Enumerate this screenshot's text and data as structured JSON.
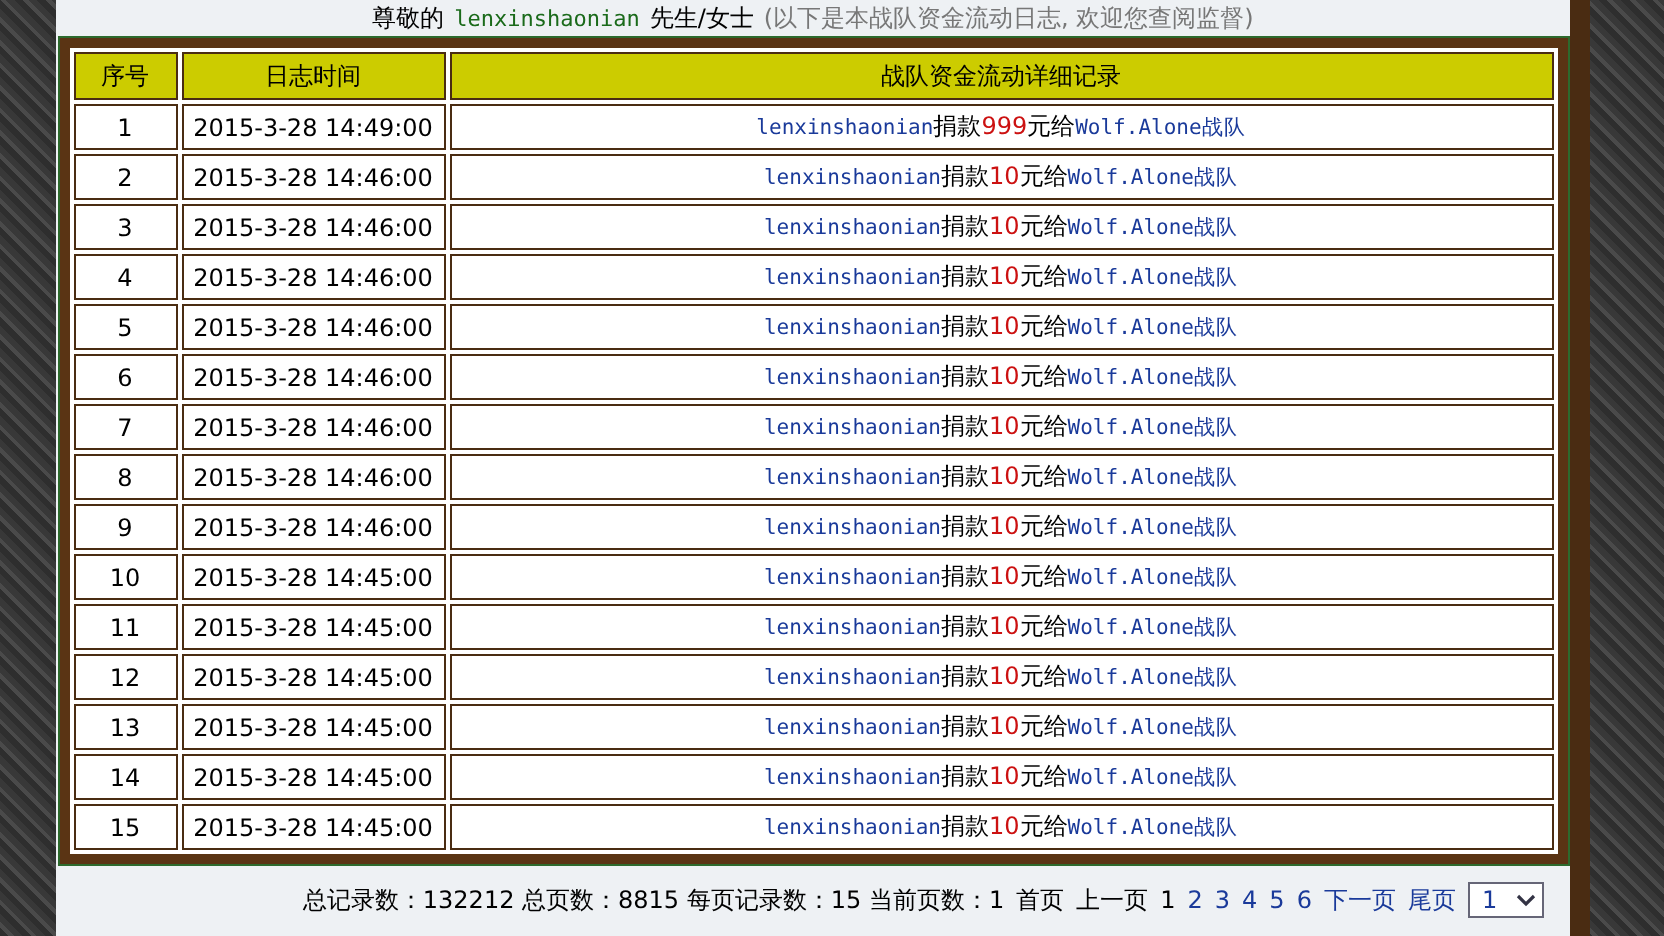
{
  "greeting": {
    "prefix": "尊敬的",
    "user": "lenxinshaonian",
    "suffix": "先生/女士",
    "note": "(以下是本战队资金流动日志, 欢迎您查阅监督)"
  },
  "table": {
    "columns": [
      "序号",
      "日志时间",
      "战队资金流动详细记录"
    ],
    "rows": [
      {
        "index": "1",
        "time": "2015-3-28 14:49:00",
        "donor": "lenxinshaonian",
        "verb": "捐款",
        "amount": "999",
        "unit": "元给",
        "team": "Wolf.Alone战队"
      },
      {
        "index": "2",
        "time": "2015-3-28 14:46:00",
        "donor": "lenxinshaonian",
        "verb": "捐款",
        "amount": "10",
        "unit": "元给",
        "team": "Wolf.Alone战队"
      },
      {
        "index": "3",
        "time": "2015-3-28 14:46:00",
        "donor": "lenxinshaonian",
        "verb": "捐款",
        "amount": "10",
        "unit": "元给",
        "team": "Wolf.Alone战队"
      },
      {
        "index": "4",
        "time": "2015-3-28 14:46:00",
        "donor": "lenxinshaonian",
        "verb": "捐款",
        "amount": "10",
        "unit": "元给",
        "team": "Wolf.Alone战队"
      },
      {
        "index": "5",
        "time": "2015-3-28 14:46:00",
        "donor": "lenxinshaonian",
        "verb": "捐款",
        "amount": "10",
        "unit": "元给",
        "team": "Wolf.Alone战队"
      },
      {
        "index": "6",
        "time": "2015-3-28 14:46:00",
        "donor": "lenxinshaonian",
        "verb": "捐款",
        "amount": "10",
        "unit": "元给",
        "team": "Wolf.Alone战队"
      },
      {
        "index": "7",
        "time": "2015-3-28 14:46:00",
        "donor": "lenxinshaonian",
        "verb": "捐款",
        "amount": "10",
        "unit": "元给",
        "team": "Wolf.Alone战队"
      },
      {
        "index": "8",
        "time": "2015-3-28 14:46:00",
        "donor": "lenxinshaonian",
        "verb": "捐款",
        "amount": "10",
        "unit": "元给",
        "team": "Wolf.Alone战队"
      },
      {
        "index": "9",
        "time": "2015-3-28 14:46:00",
        "donor": "lenxinshaonian",
        "verb": "捐款",
        "amount": "10",
        "unit": "元给",
        "team": "Wolf.Alone战队"
      },
      {
        "index": "10",
        "time": "2015-3-28 14:45:00",
        "donor": "lenxinshaonian",
        "verb": "捐款",
        "amount": "10",
        "unit": "元给",
        "team": "Wolf.Alone战队"
      },
      {
        "index": "11",
        "time": "2015-3-28 14:45:00",
        "donor": "lenxinshaonian",
        "verb": "捐款",
        "amount": "10",
        "unit": "元给",
        "team": "Wolf.Alone战队"
      },
      {
        "index": "12",
        "time": "2015-3-28 14:45:00",
        "donor": "lenxinshaonian",
        "verb": "捐款",
        "amount": "10",
        "unit": "元给",
        "team": "Wolf.Alone战队"
      },
      {
        "index": "13",
        "time": "2015-3-28 14:45:00",
        "donor": "lenxinshaonian",
        "verb": "捐款",
        "amount": "10",
        "unit": "元给",
        "team": "Wolf.Alone战队"
      },
      {
        "index": "14",
        "time": "2015-3-28 14:45:00",
        "donor": "lenxinshaonian",
        "verb": "捐款",
        "amount": "10",
        "unit": "元给",
        "team": "Wolf.Alone战队"
      },
      {
        "index": "15",
        "time": "2015-3-28 14:45:00",
        "donor": "lenxinshaonian",
        "verb": "捐款",
        "amount": "10",
        "unit": "元给",
        "team": "Wolf.Alone战队"
      }
    ]
  },
  "pagination": {
    "summary": "总记录数：132212 总页数：8815 每页记录数：15 当前页数：1",
    "links": [
      {
        "label": "首页",
        "kind": "text"
      },
      {
        "label": "上一页",
        "kind": "text"
      },
      {
        "label": "1",
        "kind": "page",
        "selected": true
      },
      {
        "label": "2",
        "kind": "page",
        "selected": false
      },
      {
        "label": "3",
        "kind": "page",
        "selected": false
      },
      {
        "label": "4",
        "kind": "page",
        "selected": false
      },
      {
        "label": "5",
        "kind": "page",
        "selected": false
      },
      {
        "label": "6",
        "kind": "page",
        "selected": false
      },
      {
        "label": "下一页",
        "kind": "link"
      },
      {
        "label": "尾页",
        "kind": "link"
      }
    ],
    "page_select": {
      "value": "1"
    }
  }
}
